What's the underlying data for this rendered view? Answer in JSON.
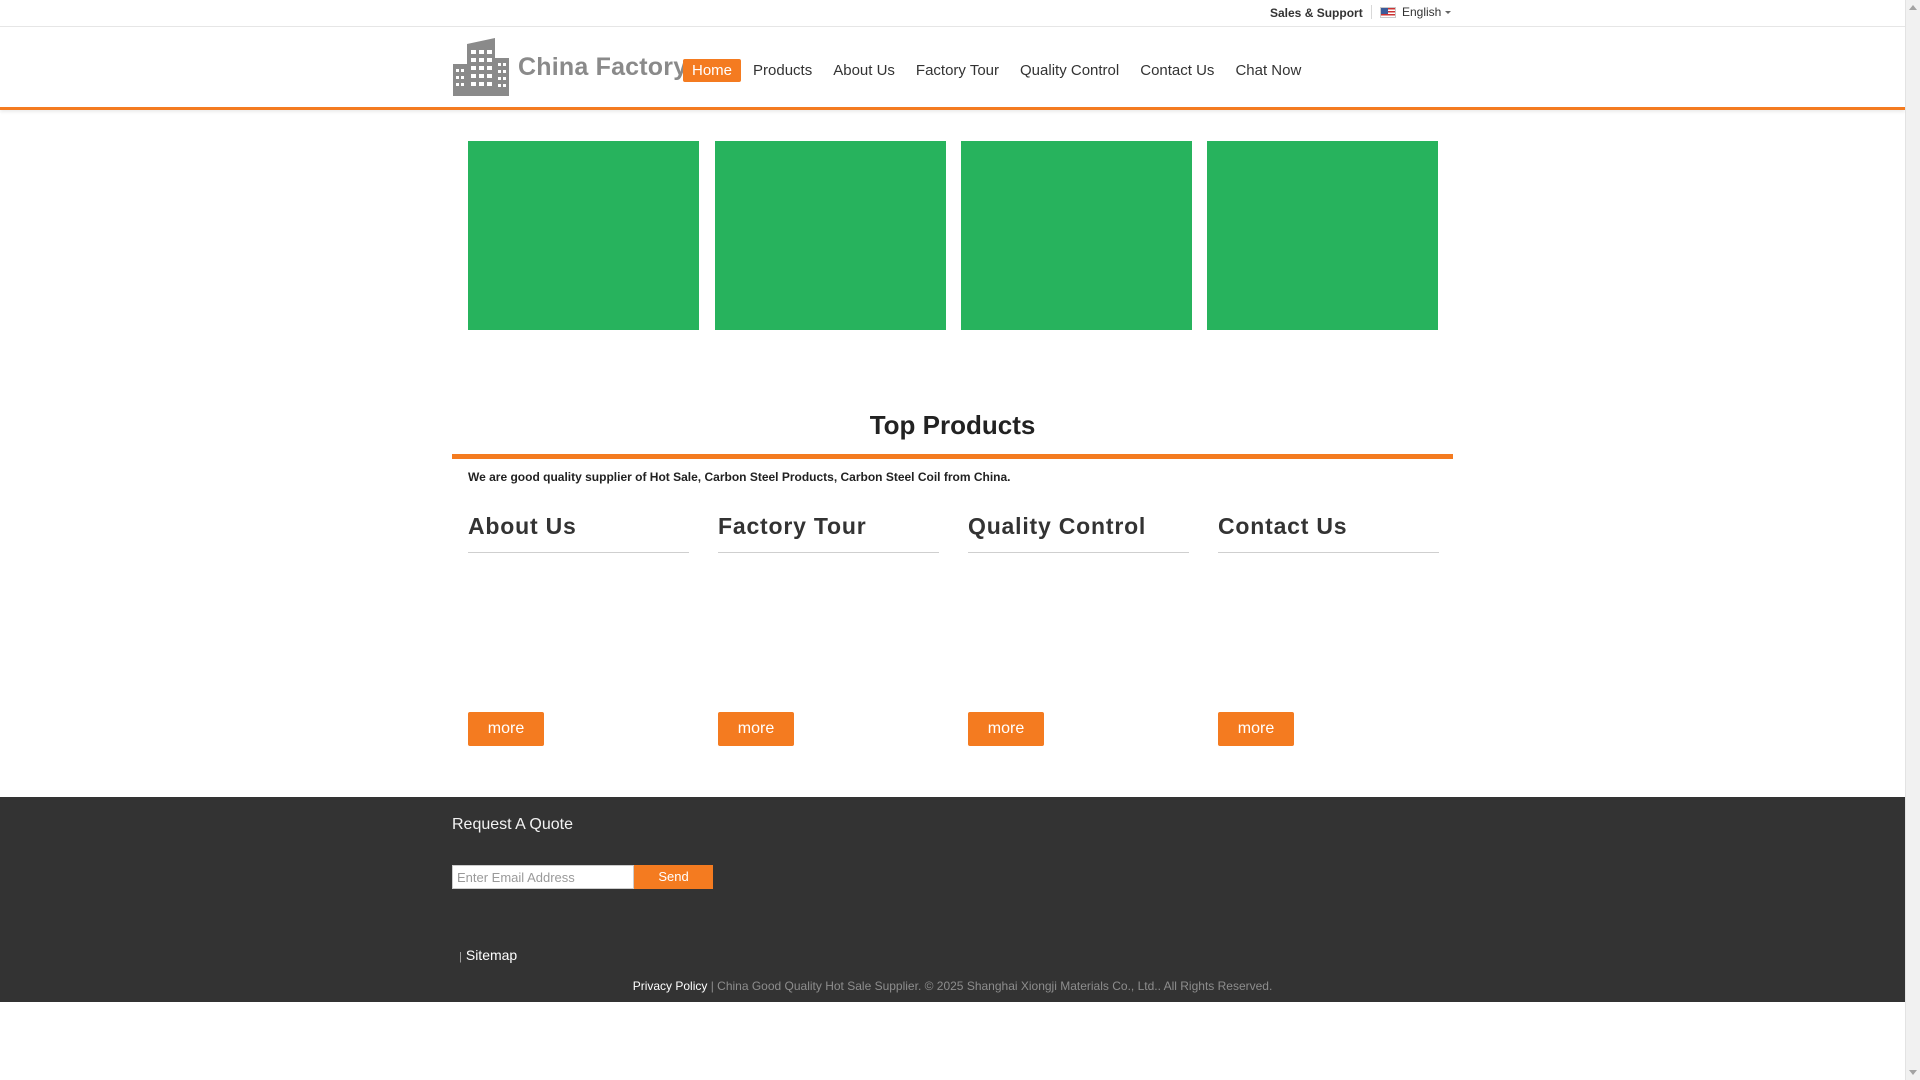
{
  "topbar": {
    "sales_support": "Sales & Support",
    "language": "English",
    "flag_icon": "us-flag-icon"
  },
  "header": {
    "logo_text": "China Factory",
    "logo_icon": "building-icon",
    "nav": [
      {
        "label": "Home",
        "active": true
      },
      {
        "label": "Products",
        "active": false
      },
      {
        "label": "About Us",
        "active": false
      },
      {
        "label": "Factory Tour",
        "active": false
      },
      {
        "label": "Quality Control",
        "active": false
      },
      {
        "label": "Contact Us",
        "active": false
      },
      {
        "label": "Chat Now",
        "active": false
      }
    ]
  },
  "top_products": {
    "title": "Top Products",
    "description": "We are good quality supplier of Hot Sale, Carbon Steel Products, Carbon Steel Coil from China."
  },
  "sections": [
    {
      "title": "About Us",
      "more_label": "more"
    },
    {
      "title": "Factory Tour",
      "more_label": "more"
    },
    {
      "title": "Quality Control",
      "more_label": "more"
    },
    {
      "title": "Contact Us",
      "more_label": "more"
    }
  ],
  "footer": {
    "request_quote_title": "Request A Quote",
    "email_placeholder": "Enter Email Address",
    "send_label": "Send",
    "sitemap_separator": "|",
    "sitemap_label": "Sitemap",
    "privacy_label": "Privacy Policy",
    "copyright_text": " | China Good Quality Hot Sale Supplier. © 2025 Shanghai Xiongji Materials Co., Ltd.. All Rights Reserved."
  },
  "colors": {
    "accent": "#f47b20",
    "tile_green": "#27b35d",
    "footer_bg": "#333333"
  }
}
